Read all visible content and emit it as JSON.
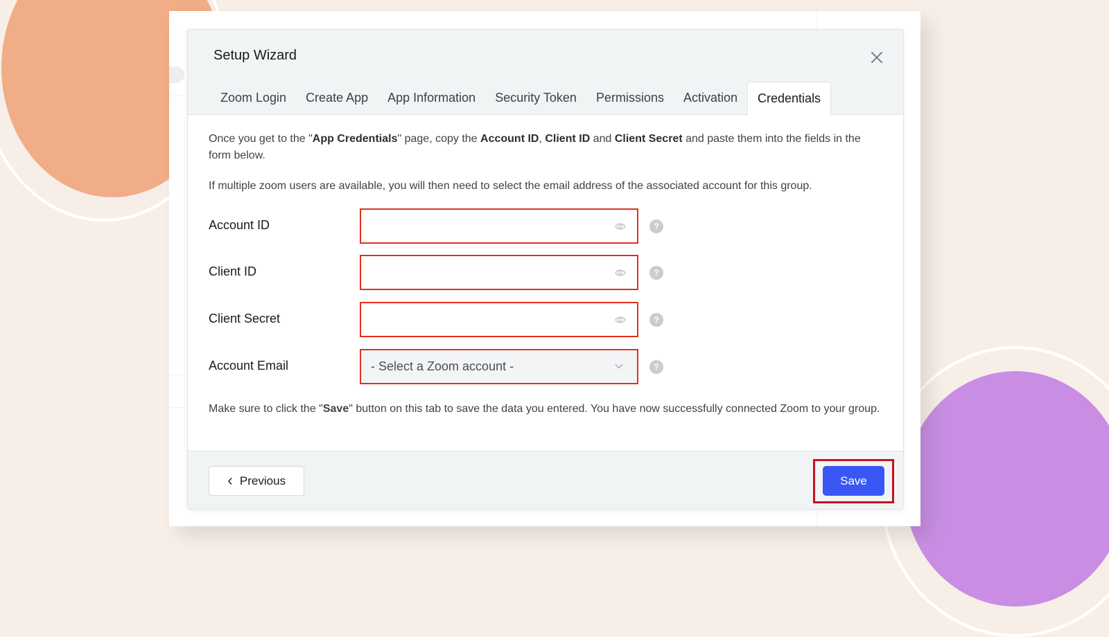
{
  "dialog": {
    "title": "Setup Wizard",
    "tabs": [
      {
        "label": "Zoom Login"
      },
      {
        "label": "Create App"
      },
      {
        "label": "App Information"
      },
      {
        "label": "Security Token"
      },
      {
        "label": "Permissions"
      },
      {
        "label": "Activation"
      },
      {
        "label": "Credentials"
      }
    ],
    "active_tab": "Credentials"
  },
  "intro": {
    "p1_a": "Once you get to the \"",
    "p1_b": "App Credentials",
    "p1_c": "\" page, copy the ",
    "p1_d": "Account ID",
    "p1_e": ", ",
    "p1_f": "Client ID",
    "p1_g": " and ",
    "p1_h": "Client Secret",
    "p1_i": " and paste them into the fields in the form below.",
    "p2": "If multiple zoom users are available, you will then need to select the email address of the associated account for this group."
  },
  "form": {
    "account_id": {
      "label": "Account ID",
      "value": "",
      "placeholder": ""
    },
    "client_id": {
      "label": "Client ID",
      "value": "",
      "placeholder": ""
    },
    "client_secret": {
      "label": "Client Secret",
      "value": "",
      "placeholder": ""
    },
    "account_email": {
      "label": "Account Email",
      "selected": "- Select a Zoom account -"
    }
  },
  "note": {
    "a": "Make sure to click the \"",
    "b": "Save",
    "c": "\" button on this tab to save the data you entered. You have now successfully connected Zoom to your group."
  },
  "footer": {
    "previous_label": "Previous",
    "save_label": "Save"
  },
  "colors": {
    "primary_button": "#3a57f5",
    "field_highlight": "#e0311f",
    "save_highlight": "#c8101e"
  },
  "icons": [
    "close-icon",
    "eye-icon",
    "help-icon",
    "chevron-down-icon",
    "chevron-left-icon"
  ]
}
